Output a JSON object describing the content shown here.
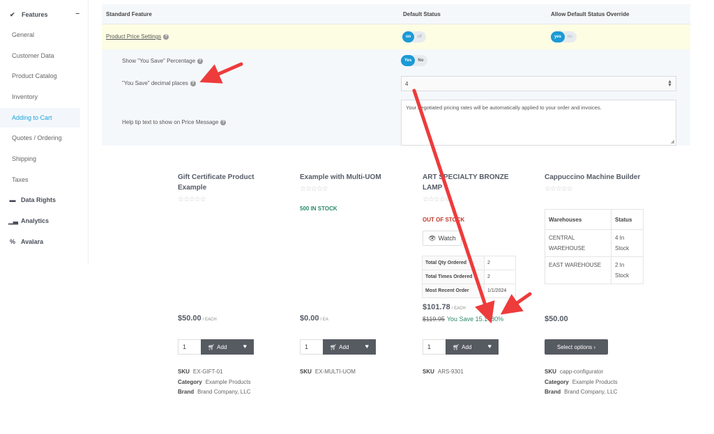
{
  "sidebar": {
    "group": {
      "label": "Features",
      "icon": "check-double-icon",
      "collapse": "–"
    },
    "items": [
      {
        "label": "General",
        "active": false
      },
      {
        "label": "Customer Data",
        "active": false
      },
      {
        "label": "Product Catalog",
        "active": false
      },
      {
        "label": "Inventory",
        "active": false
      },
      {
        "label": "Adding to Cart",
        "active": true
      },
      {
        "label": "Quotes / Ordering",
        "active": false
      },
      {
        "label": "Shipping",
        "active": false
      },
      {
        "label": "Taxes",
        "active": false
      }
    ],
    "sections": [
      {
        "label": "Data Rights",
        "icon": "database-icon",
        "glyph": "⛁"
      },
      {
        "label": "Analytics",
        "icon": "bar-chart-icon",
        "glyph": "📊"
      },
      {
        "label": "Avalara",
        "icon": "percent-icon",
        "glyph": "%"
      }
    ]
  },
  "settings": {
    "headers": {
      "feature": "Standard Feature",
      "default_status": "Default Status",
      "allow_override": "Allow Default Status Override"
    },
    "product_price_settings": {
      "label": "Product Price Settings",
      "default_status": {
        "on": "on",
        "off": "off",
        "selected": "on"
      },
      "override": {
        "on": "yes",
        "off": "no",
        "selected": "yes"
      }
    },
    "show_you_save": {
      "label": "Show \"You Save\" Percentage",
      "toggle": {
        "on": "Yes",
        "off": "No",
        "selected": "Yes"
      }
    },
    "decimal_places": {
      "label": "\"You Save\" decimal places",
      "value": "4"
    },
    "help_tip": {
      "label": "Help tip text to show on Price Message",
      "value": "Your negotiated pricing rates will be automatically applied to your order and invoices."
    }
  },
  "products": [
    {
      "title": "Gift Certificate Product Example",
      "rating_stars": "☆☆☆☆☆",
      "price": "$50.00",
      "unit": "/ EACH",
      "qty": "1",
      "add_label": "Add",
      "sku": "EX-GIFT-01",
      "category": "Example Products",
      "brand": "Brand Company, LLC"
    },
    {
      "title": "Example with Multi-UOM",
      "rating_stars": "☆☆☆☆☆",
      "stock": "500 IN STOCK",
      "price": "$0.00",
      "unit": "/ EA",
      "qty": "1",
      "add_label": "Add",
      "sku": "EX-MULTI-UOM"
    },
    {
      "title": "ART SPECIALTY BRONZE LAMP",
      "rating_stars": "☆☆☆☆☆",
      "stock": "OUT OF STOCK",
      "watch_label": "Watch",
      "order_stats": [
        {
          "label": "Total Qty Ordered",
          "value": "2"
        },
        {
          "label": "Total Times Ordered",
          "value": "2"
        },
        {
          "label": "Most Recent Order",
          "value": "1/1/2024"
        }
      ],
      "price": "$101.78",
      "unit": "/ EACH",
      "old_price": "$119.95",
      "you_save": "You Save 15.1480%",
      "qty": "1",
      "add_label": "Add",
      "sku": "ARS-9301"
    },
    {
      "title": "Cappuccino Machine Builder",
      "rating_stars": "☆☆☆☆☆",
      "warehouse_headers": [
        "Warehouses",
        "Status"
      ],
      "warehouses": [
        {
          "name": "CENTRAL WAREHOUSE",
          "status": "4 In Stock"
        },
        {
          "name": "EAST WAREHOUSE",
          "status": "2 In Stock"
        }
      ],
      "price": "$50.00",
      "select_label": "Select options ›",
      "sku": "capp-configurator",
      "category": "Example Products",
      "brand": "Brand Company, LLC"
    }
  ],
  "meta_labels": {
    "sku": "SKU",
    "category": "Category",
    "brand": "Brand"
  },
  "colors": {
    "accent": "#1b9ad6",
    "active_nav": "#1ea3dd",
    "save_green": "#2a8a6a",
    "out_red": "#c0392b",
    "arrow": "#ee3b3b",
    "highlight_row": "#fcfde3"
  }
}
